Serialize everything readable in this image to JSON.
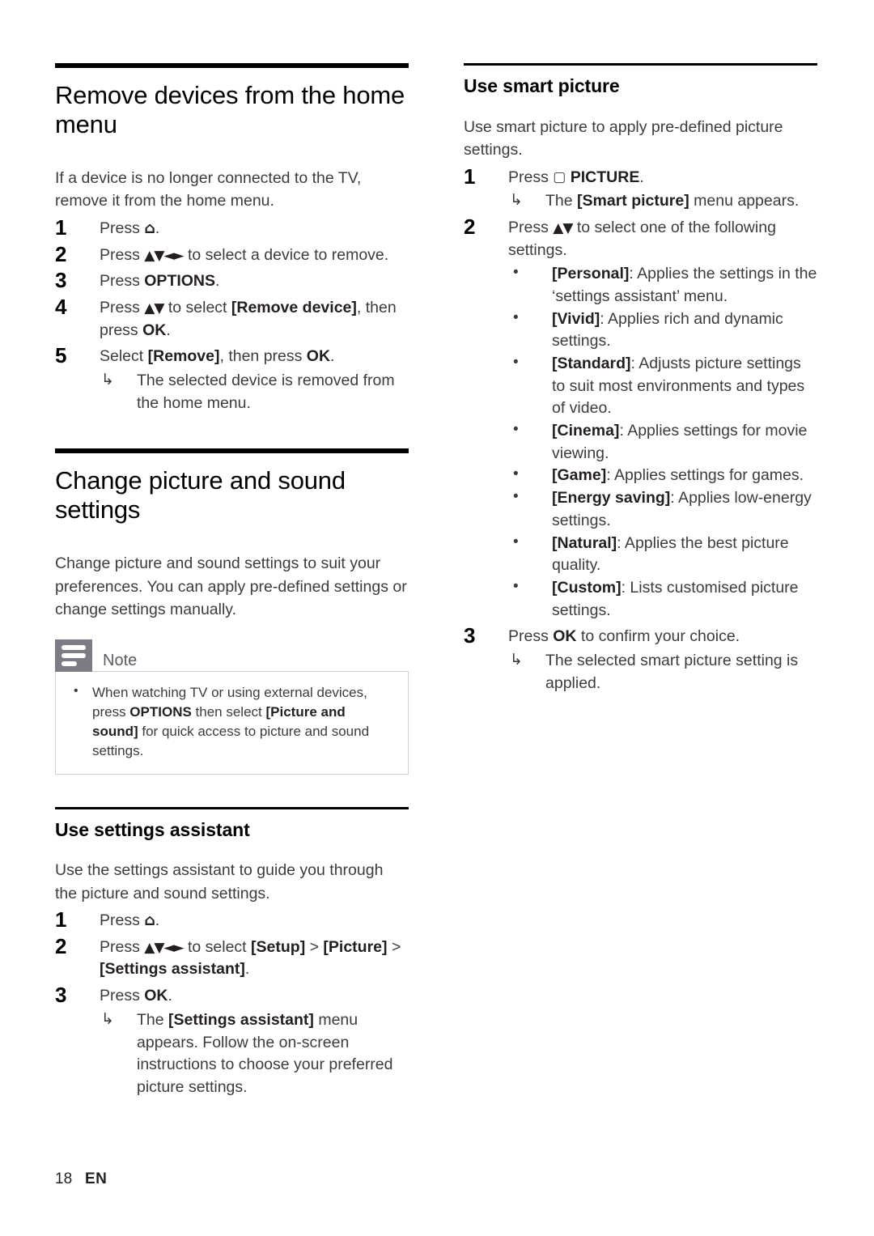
{
  "page": {
    "number": "18",
    "language": "EN"
  },
  "icons": {
    "home": "⌂",
    "home_label": "home-icon",
    "nav_updown": "▲▼",
    "nav_all": "▲▼◄►",
    "picture_button": "▢",
    "arrow": "↳",
    "bullet": "•"
  },
  "left_column": {
    "section1": {
      "title": "Remove devices from the home menu",
      "intro": "If a device is no longer connected to the TV, remove it from the home menu.",
      "steps": [
        {
          "num": "1",
          "text_pre": "Press ",
          "glyph": "home",
          "text_post": "."
        },
        {
          "num": "2",
          "text_pre": "Press ",
          "glyph": "nav_all",
          "text_post": " to select a device to remove."
        },
        {
          "num": "3",
          "text_pre": "Press ",
          "bold": "OPTIONS",
          "text_post": "."
        },
        {
          "num": "4",
          "text_pre": "Press ",
          "glyph": "nav_updown",
          "mid": " to select ",
          "bold": "[Remove device]",
          "tail": ", then press ",
          "bold2": "OK",
          "end": "."
        },
        {
          "num": "5",
          "text_pre": "Select ",
          "bold": "[Remove]",
          "tail": ", then press ",
          "bold2": "OK",
          "end": ".",
          "note": "The selected device is removed from the home menu."
        }
      ]
    },
    "section2": {
      "title": "Change picture and sound settings",
      "intro": "Change picture and sound settings to suit your preferences. You can apply pre-defined settings or change settings manually.",
      "note": {
        "label": "Note",
        "text_1": "When watching TV or using external devices, press ",
        "bold_1": "OPTIONS",
        "text_2": " then select ",
        "bold_2": "[Picture and sound]",
        "text_3": " for quick access to picture and sound settings."
      }
    },
    "section3": {
      "title": "Use settings assistant",
      "intro": "Use the settings assistant to guide you through the picture and sound settings.",
      "steps": [
        {
          "num": "1",
          "text_pre": "Press ",
          "glyph": "home",
          "text_post": "."
        },
        {
          "num": "2",
          "text_pre": "Press ",
          "glyph": "nav_all",
          "mid": " to select ",
          "bold": "[Setup]",
          "tail": " > ",
          "bold2": "[Picture]",
          "tail2": " > ",
          "bold3": "[Settings assistant]",
          "end": "."
        },
        {
          "num": "3",
          "text_pre": "Press ",
          "bold": "OK",
          "end": ".",
          "note_pre": "The ",
          "note_bold": "[Settings assistant]",
          "note_post": " menu appears. Follow the on-screen instructions to choose your preferred picture settings."
        }
      ]
    }
  },
  "right_column": {
    "section1": {
      "title": "Use smart picture",
      "intro": "Use smart picture to apply pre-defined picture settings.",
      "step1": {
        "num": "1",
        "text_pre": "Press ",
        "glyph": "picture_button",
        "bold": " PICTURE",
        "end": ".",
        "note_pre": "The ",
        "note_bold": "[Smart picture]",
        "note_post": " menu appears."
      },
      "step2": {
        "num": "2",
        "text_pre": "Press ",
        "glyph": "nav_updown",
        "text_post": " to select one of the following settings.",
        "options": [
          {
            "name": "[Personal]",
            "desc": ": Applies the settings in the ‘settings assistant’ menu."
          },
          {
            "name": "[Vivid]",
            "desc": ": Applies rich and dynamic settings."
          },
          {
            "name": "[Standard]",
            "desc": ": Adjusts picture settings to suit most environments and types of video."
          },
          {
            "name": "[Cinema]",
            "desc": ": Applies settings for movie viewing."
          },
          {
            "name": "[Game]",
            "desc": ": Applies settings for games."
          },
          {
            "name": "[Energy saving]",
            "desc": ": Applies low-energy settings."
          },
          {
            "name": "[Natural]",
            "desc": ": Applies the best picture quality."
          },
          {
            "name": "[Custom]",
            "desc": ": Lists customised picture settings."
          }
        ]
      },
      "step3": {
        "num": "3",
        "text_pre": "Press ",
        "bold": "OK",
        "text_post": " to confirm your choice.",
        "note": "The selected smart picture setting is applied."
      }
    }
  },
  "colors": {
    "text": "#3c3c3f",
    "heading": "#000000",
    "note_icon_bg": "#7c7c85",
    "note_border": "#cfcfd4"
  }
}
